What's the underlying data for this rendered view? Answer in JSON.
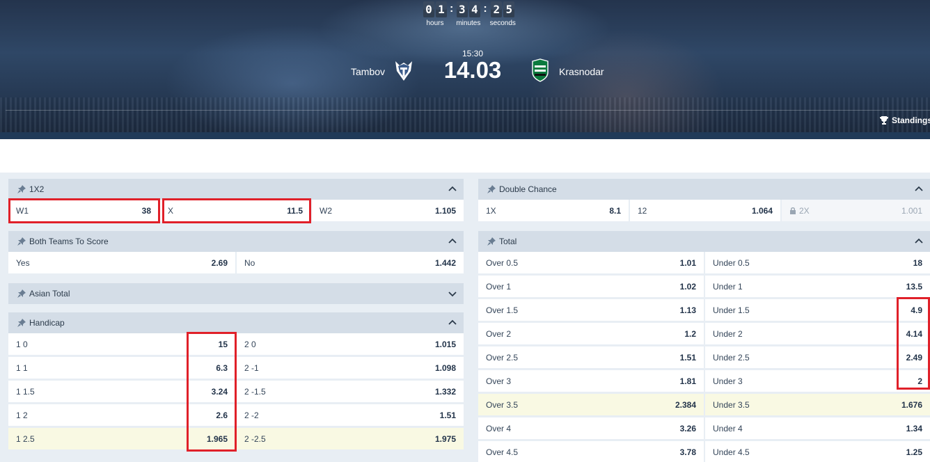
{
  "header": {
    "countdown": {
      "hours": [
        "0",
        "1"
      ],
      "minutes": [
        "3",
        "4"
      ],
      "seconds": [
        "2",
        "5"
      ],
      "labels": {
        "hours": "hours",
        "minutes": "minutes",
        "seconds": "seconds"
      }
    },
    "match": {
      "time": "15:30",
      "date": "14.03",
      "team1": "Tambov",
      "team2": "Krasnodar"
    },
    "standings_label": "Standings"
  },
  "markets": {
    "m1x2": {
      "title": "1X2",
      "outcomes": [
        {
          "label": "W1",
          "odd": "38"
        },
        {
          "label": "X",
          "odd": "11.5"
        },
        {
          "label": "W2",
          "odd": "1.105"
        }
      ]
    },
    "btts": {
      "title": "Both Teams To Score",
      "outcomes": [
        {
          "label": "Yes",
          "odd": "2.69"
        },
        {
          "label": "No",
          "odd": "1.442"
        }
      ]
    },
    "asian_total": {
      "title": "Asian Total"
    },
    "handicap": {
      "title": "Handicap",
      "rows": [
        {
          "l1": "1 0",
          "o1": "15",
          "l2": "2 0",
          "o2": "1.015"
        },
        {
          "l1": "1 1",
          "o1": "6.3",
          "l2": "2 -1",
          "o2": "1.098"
        },
        {
          "l1": "1 1.5",
          "o1": "3.24",
          "l2": "2 -1.5",
          "o2": "1.332"
        },
        {
          "l1": "1 2",
          "o1": "2.6",
          "l2": "2 -2",
          "o2": "1.51"
        },
        {
          "l1": "1 2.5",
          "o1": "1.965",
          "l2": "2 -2.5",
          "o2": "1.975"
        }
      ]
    },
    "double_chance": {
      "title": "Double Chance",
      "outcomes": [
        {
          "label": "1X",
          "odd": "8.1"
        },
        {
          "label": "12",
          "odd": "1.064"
        },
        {
          "label": "2X",
          "odd": "1.001"
        }
      ]
    },
    "total": {
      "title": "Total",
      "rows": [
        {
          "l1": "Over 0.5",
          "o1": "1.01",
          "l2": "Under 0.5",
          "o2": "18"
        },
        {
          "l1": "Over 1",
          "o1": "1.02",
          "l2": "Under 1",
          "o2": "13.5"
        },
        {
          "l1": "Over 1.5",
          "o1": "1.13",
          "l2": "Under 1.5",
          "o2": "4.9"
        },
        {
          "l1": "Over 2",
          "o1": "1.2",
          "l2": "Under 2",
          "o2": "4.14"
        },
        {
          "l1": "Over 2.5",
          "o1": "1.51",
          "l2": "Under 2.5",
          "o2": "2.49"
        },
        {
          "l1": "Over 3",
          "o1": "1.81",
          "l2": "Under 3",
          "o2": "2"
        },
        {
          "l1": "Over 3.5",
          "o1": "2.384",
          "l2": "Under 3.5",
          "o2": "1.676"
        },
        {
          "l1": "Over 4",
          "o1": "3.26",
          "l2": "Under 4",
          "o2": "1.34"
        },
        {
          "l1": "Over 4.5",
          "o1": "3.78",
          "l2": "Under 4.5",
          "o2": "1.25"
        }
      ]
    }
  },
  "colors": {
    "accent_red": "#e02029",
    "panel_header": "#d4dde7",
    "highlight_row": "#f9f9e3",
    "hero_bg": "#2f4766"
  }
}
